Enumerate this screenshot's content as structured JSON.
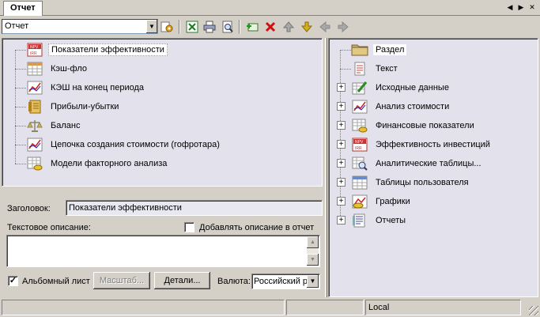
{
  "tab": {
    "label": "Отчет"
  },
  "toolbar": {
    "report_select_value": "Отчет",
    "icons": [
      "settings-gear-icon",
      "excel-export-icon",
      "print-icon",
      "preview-icon",
      "add-icon",
      "delete-icon",
      "move-up-icon",
      "move-down-icon",
      "move-left-icon",
      "move-right-icon"
    ]
  },
  "left_tree": {
    "items": [
      {
        "label": "Показатели эффективности",
        "icon": "npv-irr-icon",
        "selected": true
      },
      {
        "label": "Кэш-фло",
        "icon": "table-icon"
      },
      {
        "label": "КЭШ на конец периода",
        "icon": "chart-icon"
      },
      {
        "label": "Прибыли-убытки",
        "icon": "ledger-icon"
      },
      {
        "label": "Баланс",
        "icon": "scales-icon"
      },
      {
        "label": "Цепочка создания стоимости (гофротара)",
        "icon": "chart-icon"
      },
      {
        "label": "Модели факторного анализа",
        "icon": "table-coins-icon"
      }
    ]
  },
  "form": {
    "title_label": "Заголовок:",
    "title_value": "Показатели эффективности",
    "desc_label": "Текстовое описание:",
    "add_desc_label": "Добавлять описание в отчет",
    "add_desc_checked": false,
    "landscape_label": "Альбомный лист",
    "landscape_checked": true,
    "scale_button": "Масштаб...",
    "details_button": "Детали...",
    "currency_label": "Валюта:",
    "currency_value": "Российский р"
  },
  "right_tree": {
    "items": [
      {
        "label": "Раздел",
        "icon": "folder-icon",
        "expandable": false,
        "selected": true
      },
      {
        "label": "Текст",
        "icon": "text-doc-icon",
        "expandable": false
      },
      {
        "label": "Исходные данные",
        "icon": "input-data-icon",
        "expandable": true
      },
      {
        "label": "Анализ стоимости",
        "icon": "chart-icon",
        "expandable": true
      },
      {
        "label": "Финансовые показатели",
        "icon": "table-coins-icon",
        "expandable": true
      },
      {
        "label": "Эффективность инвестиций",
        "icon": "npv-irr-icon",
        "expandable": true
      },
      {
        "label": "Аналитические таблицы...",
        "icon": "table-magnifier-icon",
        "expandable": true
      },
      {
        "label": "Таблицы пользователя",
        "icon": "user-table-icon",
        "expandable": true
      },
      {
        "label": "Графики",
        "icon": "graph-icon",
        "expandable": true
      },
      {
        "label": "Отчеты",
        "icon": "reports-icon",
        "expandable": true
      }
    ]
  },
  "status": {
    "cell1": "",
    "cell2": "",
    "cell3": "Local"
  }
}
